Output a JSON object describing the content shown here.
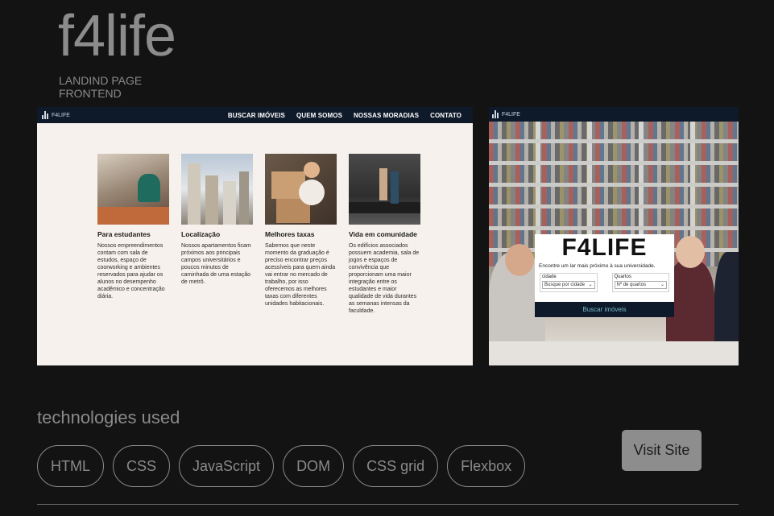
{
  "project": {
    "title": "f4life",
    "subtitle_line1": "LANDIND PAGE",
    "subtitle_line2": "FRONTEND"
  },
  "preview_left": {
    "logo_text": "F4LIFE",
    "nav_links": [
      "BUSCAR IMÓVEIS",
      "QUEM SOMOS",
      "NOSSAS MORADIAS",
      "CONTATO"
    ],
    "cards": [
      {
        "title": "Para estudantes",
        "text": "Nossos empreendimentos contam com sala de estudos, espaço de coorworking e ambientes reservados para ajudar os alunos no desempenho acadêmico e concentração diária."
      },
      {
        "title": "Localização",
        "text": "Nossos apartamentos ficam próximos aos principais campos universitários e poucos minutos de caminhada de uma estação de metrô."
      },
      {
        "title": "Melhores taxas",
        "text": "Sabemos que neste momento da graduação é preciso encontrar preços acessíveis para quem ainda vai entrar no mercado de trabalho, por isso oferecemos as melhores taxas com diferentes unidades habitacionais."
      },
      {
        "title": "Vida em comunidade",
        "text": "Os edifícios associados possuem academia, sala de jogos e espaços de convivência que proporcionam uma maior integração entre os estudantes e maior qualidade de vida durantes as semanas intensas da faculdade."
      }
    ]
  },
  "preview_right": {
    "logo_text": "F4LIFE",
    "hero_title": "F4LIFE",
    "hint": "Encontre um lar mais próximo à sua universidade.",
    "field1_label": "cidade",
    "field1_value": "Busque por cidade",
    "field2_label": "Quartos",
    "field2_value": "Nº de quartos",
    "button": "Buscar imóveis"
  },
  "tech": {
    "heading": "technologies used",
    "items": [
      "HTML",
      "CSS",
      "JavaScript",
      "DOM",
      "CSS grid",
      "Flexbox"
    ]
  },
  "visit_label": "Visit Site"
}
